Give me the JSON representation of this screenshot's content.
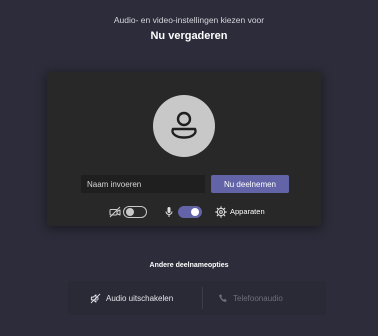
{
  "header": {
    "subtitle": "Audio- en video-instellingen kiezen voor",
    "title": "Nu vergaderen"
  },
  "prejoin": {
    "name_placeholder": "Naam invoeren",
    "join_label": "Nu deelnemen",
    "camera": {
      "icon": "camera-off-icon",
      "enabled": false
    },
    "microphone": {
      "icon": "microphone-icon",
      "enabled": true
    },
    "devices_label": "Apparaten",
    "devices_icon": "gear-icon"
  },
  "other_options": {
    "heading": "Andere deelnameopties",
    "audio_off_label": "Audio uitschakelen",
    "phone_label": "Telefoonaudio"
  },
  "colors": {
    "background": "#2c2c3a",
    "card": "#282828",
    "accent": "#6264a7"
  }
}
